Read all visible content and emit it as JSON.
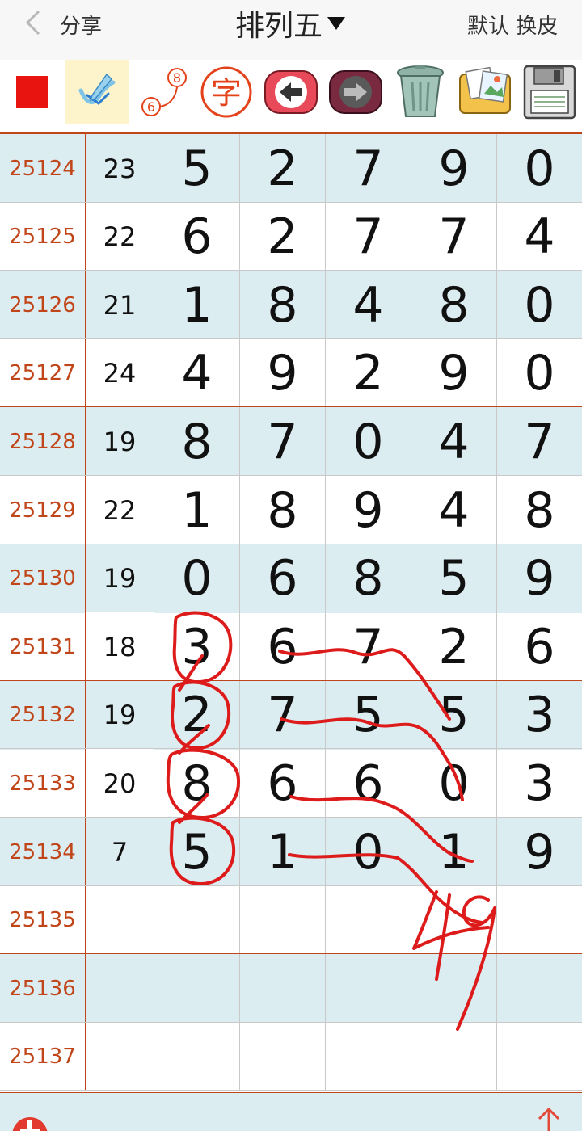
{
  "header": {
    "share_label": "分享",
    "title": "排列五",
    "skin_label": "默认 换皮"
  },
  "toolbar": {
    "icons": [
      "stop-icon",
      "pen-icon",
      "counter-icon",
      "char-icon",
      "undo-icon",
      "redo-icon",
      "trash-icon",
      "gallery-icon",
      "save-icon"
    ],
    "counter_top": "8",
    "counter_bottom": "6",
    "char_label": "字"
  },
  "colors": {
    "issue_text": "#c0461a",
    "shaded_row": "#dcedf2",
    "annotation": "#dd1b1b"
  },
  "rows": [
    {
      "issue": "25124",
      "sum": "23",
      "digits": [
        "5",
        "2",
        "7",
        "9",
        "0"
      ]
    },
    {
      "issue": "25125",
      "sum": "22",
      "digits": [
        "6",
        "2",
        "7",
        "7",
        "4"
      ]
    },
    {
      "issue": "25126",
      "sum": "21",
      "digits": [
        "1",
        "8",
        "4",
        "8",
        "0"
      ]
    },
    {
      "issue": "25127",
      "sum": "24",
      "digits": [
        "4",
        "9",
        "2",
        "9",
        "0"
      ]
    },
    {
      "issue": "25128",
      "sum": "19",
      "digits": [
        "8",
        "7",
        "0",
        "4",
        "7"
      ]
    },
    {
      "issue": "25129",
      "sum": "22",
      "digits": [
        "1",
        "8",
        "9",
        "4",
        "8"
      ]
    },
    {
      "issue": "25130",
      "sum": "19",
      "digits": [
        "0",
        "6",
        "8",
        "5",
        "9"
      ]
    },
    {
      "issue": "25131",
      "sum": "18",
      "digits": [
        "3",
        "6",
        "7",
        "2",
        "6"
      ]
    },
    {
      "issue": "25132",
      "sum": "19",
      "digits": [
        "2",
        "7",
        "5",
        "5",
        "3"
      ]
    },
    {
      "issue": "25133",
      "sum": "20",
      "digits": [
        "8",
        "6",
        "6",
        "0",
        "3"
      ]
    },
    {
      "issue": "25134",
      "sum": "7",
      "digits": [
        "5",
        "1",
        "0",
        "1",
        "9"
      ]
    },
    {
      "issue": "25135",
      "sum": "",
      "digits": [
        "",
        "",
        "",
        "",
        ""
      ]
    },
    {
      "issue": "25136",
      "sum": "",
      "digits": [
        "",
        "",
        "",
        "",
        ""
      ]
    },
    {
      "issue": "25137",
      "sum": "",
      "digits": [
        "",
        "",
        "",
        "",
        ""
      ]
    }
  ]
}
